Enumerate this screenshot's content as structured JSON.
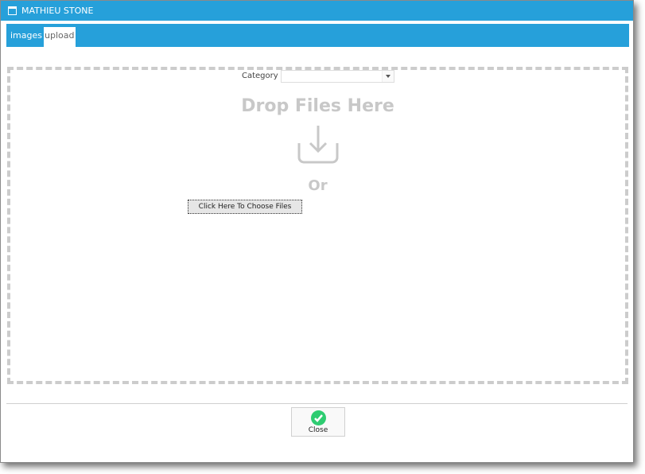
{
  "window": {
    "title": "MATHIEU STONE"
  },
  "tabs": [
    {
      "label": "images",
      "active": false
    },
    {
      "label": "upload",
      "active": true
    }
  ],
  "upload": {
    "category_label": "Category",
    "category_value": "",
    "drop_text": "Drop Files Here",
    "or_text": "Or",
    "choose_button": "Click Here To Choose Files"
  },
  "footer": {
    "close_label": "Close"
  },
  "colors": {
    "accent": "#26a0da",
    "dropzone_border": "#cccccc",
    "success": "#2ecc71"
  }
}
